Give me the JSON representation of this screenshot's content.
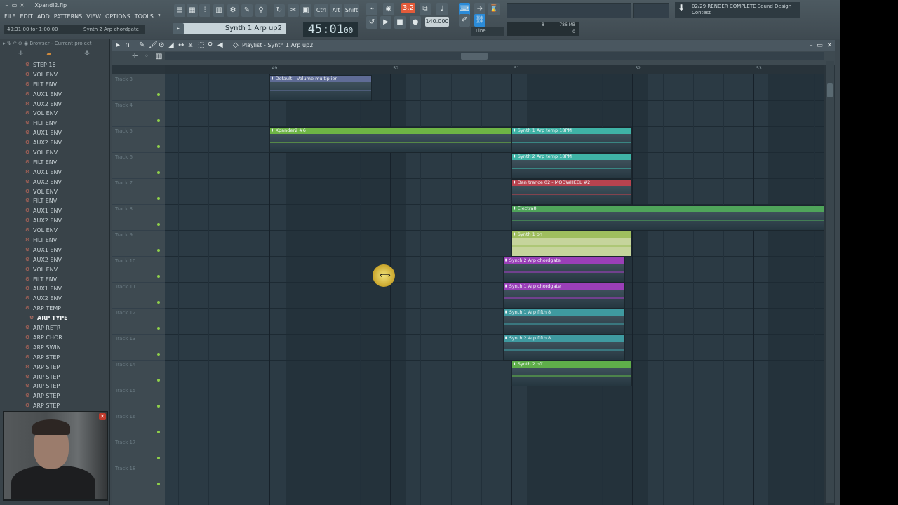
{
  "window": {
    "title": "Xpandl2.flp"
  },
  "menu": [
    "FILE",
    "EDIT",
    "ADD",
    "PATTERNS",
    "VIEW",
    "OPTIONS",
    "TOOLS",
    "?"
  ],
  "hint": {
    "left": "49:31:00 for 1:00:00",
    "right": "Synth 2 Arp chordgate"
  },
  "transport": {
    "pattern": "Synth 1 Arp up2",
    "time": "45:01",
    "time_sub": "00",
    "tempo": "140.000",
    "rec_pattern_label": "3.2",
    "snap": "Line"
  },
  "cpu": {
    "mem": "786 MB",
    "a": "8",
    "b": "0"
  },
  "news": {
    "line1": "RENDER COMPLETE Sound Design",
    "line2": "Contest",
    "prefix": "02/29"
  },
  "toolbar_keys": [
    "Ctrl",
    "Alt",
    "Shift"
  ],
  "browser": {
    "header": "Browser - Current project",
    "items": [
      "STEP 16",
      "VOL ENV",
      "FILT ENV",
      "AUX1 ENV",
      "AUX2 ENV",
      "VOL ENV",
      "FILT ENV",
      "AUX1 ENV",
      "AUX2 ENV",
      "VOL ENV",
      "FILT ENV",
      "AUX1 ENV",
      "AUX2 ENV",
      "VOL ENV",
      "FILT ENV",
      "AUX1 ENV",
      "AUX2 ENV",
      "VOL ENV",
      "FILT ENV",
      "AUX1 ENV",
      "AUX2 ENV",
      "VOL ENV",
      "FILT ENV",
      "AUX1 ENV",
      "AUX2 ENV",
      "ARP TEMP",
      "ARP TYPE",
      "ARP RETR",
      "ARP CHOR",
      "ARP SWIN",
      "ARP STEP",
      "ARP STEP",
      "ARP STEP",
      "ARP STEP",
      "ARP STEP",
      "ARP STEP",
      "ARP STEP"
    ],
    "selected_index": 26
  },
  "playlist": {
    "title": "Playlist - Synth 1 Arp up2",
    "bars": [
      "49",
      "50",
      "51",
      "52",
      "53"
    ],
    "tracks": [
      "Track 3",
      "Track 4",
      "Track 5",
      "Track 6",
      "Track 7",
      "Track 8",
      "Track 9",
      "Track 10",
      "Track 11",
      "Track 12",
      "Track 13",
      "Track 14",
      "Track 15",
      "Track 16",
      "Track 17",
      "Track 18"
    ],
    "clips": [
      {
        "track": 0,
        "start": 48.0,
        "end": 48.85,
        "name": "Default - Volume multiplier",
        "color": "#5f6c96"
      },
      {
        "track": 2,
        "start": 48.0,
        "end": 50.0,
        "name": "Xpander2 #6",
        "color": "#6eb545"
      },
      {
        "track": 2,
        "start": 50.0,
        "end": 51.0,
        "name": "Synth 1 Arp temp 18PM",
        "color": "#3fb3a6"
      },
      {
        "track": 3,
        "start": 50.0,
        "end": 51.0,
        "name": "Synth 2 Arp temp 18PM",
        "color": "#3fb3a6"
      },
      {
        "track": 4,
        "start": 50.0,
        "end": 51.0,
        "name": "Dan trance 02 - MODWHEEL #2",
        "color": "#b8434f"
      },
      {
        "track": 5,
        "start": 50.0,
        "end": 53.6,
        "name": "Electra8",
        "color": "#4fa45a"
      },
      {
        "track": 6,
        "start": 50.0,
        "end": 51.0,
        "name": "Synth 1 on",
        "color": "#9fbe5e"
      },
      {
        "track": 7,
        "start": 49.93,
        "end": 50.94,
        "name": "Synth 2 Arp chordgate",
        "color": "#9a3fb8"
      },
      {
        "track": 8,
        "start": 49.93,
        "end": 50.94,
        "name": "Synth 1 Arp chordgate",
        "color": "#9a3fb8"
      },
      {
        "track": 9,
        "start": 49.93,
        "end": 50.94,
        "name": "Synth 1 Arp fifth 8",
        "color": "#3f9aa0"
      },
      {
        "track": 10,
        "start": 49.93,
        "end": 50.94,
        "name": "Synth 2 Arp fifth 8",
        "color": "#3f9aa0"
      },
      {
        "track": 11,
        "start": 50.0,
        "end": 51.0,
        "name": "Synth 2 off",
        "color": "#5fae4a"
      }
    ]
  },
  "colors": {
    "accent": "#e35b3a",
    "panel": "#3c474e",
    "grid": "#2b3a44"
  }
}
